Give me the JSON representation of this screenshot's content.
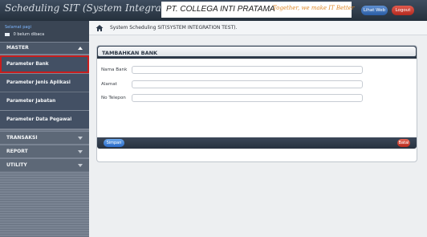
{
  "app_title": "Scheduling SIT (System Integration Test)",
  "company": {
    "name": "PT. COLLEGA INTI PRATAMA",
    "tagline": "Together, we make IT Better"
  },
  "header_buttons": {
    "web_label": "Lihat Web",
    "logout_label": "Logout"
  },
  "user_area": {
    "link_label": "Selamat pagi",
    "message_label": "0 belum dibaca"
  },
  "sidebar": {
    "master_label": "MASTER",
    "master_items": [
      {
        "label": "Parameter Bank",
        "active": true
      },
      {
        "label": "Parameter Jenis Aplikasi",
        "active": false
      },
      {
        "label": "Parameter Jabatan",
        "active": false
      },
      {
        "label": "Parameter Data Pegawai",
        "active": false
      }
    ],
    "groups": [
      {
        "label": "TRANSAKSI"
      },
      {
        "label": "REPORT"
      },
      {
        "label": "UTILITY"
      }
    ]
  },
  "breadcrumb": {
    "text": "System Scheduling SIT(SYSTEM INTEGRATION TEST)."
  },
  "form": {
    "title": "TAMBAHKAN BANK",
    "fields": [
      {
        "label": "Nama Bank",
        "value": "",
        "placeholder": ""
      },
      {
        "label": "Alamat",
        "value": "",
        "placeholder": ""
      },
      {
        "label": "No Telepon",
        "value": "",
        "placeholder": ""
      }
    ],
    "save_label": "Simpan",
    "cancel_label": "Batal"
  },
  "colors": {
    "header_bg": "#2f3a48",
    "sidebar_bg": "#6e7887",
    "active_outline": "#c81e1e",
    "save_button": "#2a6ac7",
    "cancel_button": "#b72a1e",
    "tagline": "#e08a2a"
  },
  "icons": {
    "home": "home-icon",
    "mail": "mail-icon"
  }
}
